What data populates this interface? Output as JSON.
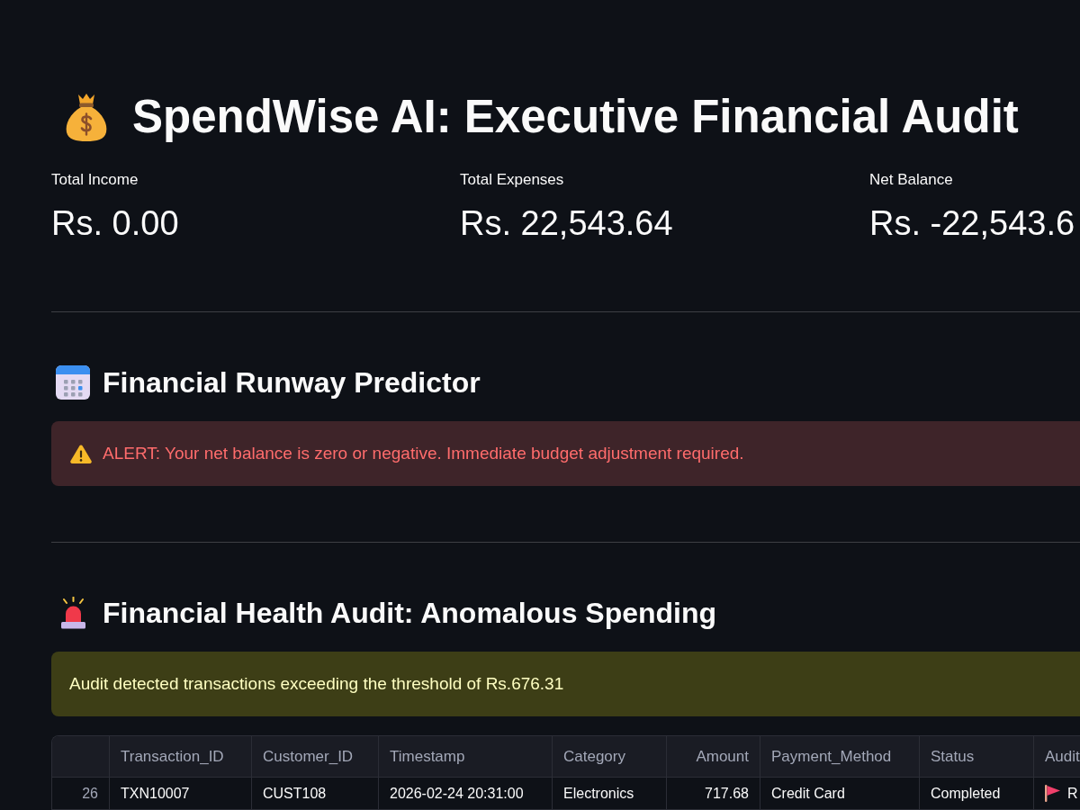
{
  "header": {
    "title": "SpendWise AI: Executive Financial Audit"
  },
  "metrics": [
    {
      "label": "Total Income",
      "value": "Rs. 0.00"
    },
    {
      "label": "Total Expenses",
      "value": "Rs. 22,543.64"
    },
    {
      "label": "Net Balance",
      "value": "Rs. -22,543.6"
    }
  ],
  "sections": [
    {
      "kind": "runway",
      "title": "Financial Runway Predictor",
      "alert": {
        "kind": "error",
        "text": "ALERT: Your net balance is zero or negative. Immediate budget adjustment required."
      }
    },
    {
      "kind": "audit",
      "title": "Financial Health Audit: Anomalous Spending",
      "alert": {
        "kind": "warning",
        "text": "Audit detected transactions exceeding the threshold of Rs.676.31"
      },
      "table": {
        "columns": [
          {
            "label": "Transaction_ID",
            "kind": "text"
          },
          {
            "label": "Customer_ID",
            "kind": "text"
          },
          {
            "label": "Timestamp",
            "kind": "text"
          },
          {
            "label": "Category",
            "kind": "text"
          },
          {
            "label": "Amount",
            "kind": "number"
          },
          {
            "label": "Payment_Method",
            "kind": "text"
          },
          {
            "label": "Status",
            "kind": "text"
          },
          {
            "label": "Audit",
            "kind": "flag"
          }
        ],
        "rows": [
          {
            "index": "26",
            "cells": [
              "TXN10007",
              "CUST108",
              "2026-02-24 20:31:00",
              "Electronics",
              "717.68",
              "Credit Card",
              "Completed",
              "R"
            ]
          }
        ]
      }
    }
  ]
}
